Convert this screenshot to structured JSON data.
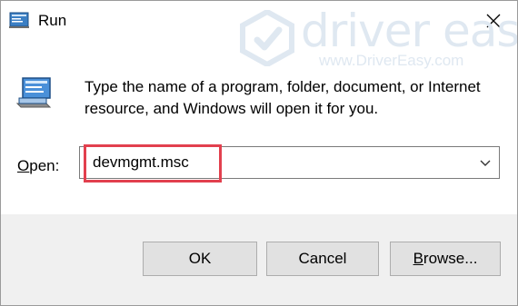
{
  "window": {
    "title": "Run"
  },
  "watermark": {
    "brand": "driver easy",
    "url": "www.DriverEasy.com"
  },
  "description": "Type the name of a program, folder, document, or Internet resource, and Windows will open it for you.",
  "open": {
    "label": "Open:",
    "value": "devmgmt.msc"
  },
  "buttons": {
    "ok": "OK",
    "cancel": "Cancel",
    "browse_first": "B",
    "browse_rest": "rowse..."
  },
  "colors": {
    "highlight": "#e2404e",
    "footer": "#f0f0f0",
    "button": "#e1e1e1"
  },
  "icons": [
    "run-app-icon",
    "close-icon",
    "run-large-icon",
    "chevron-down-icon",
    "drivereasy-logo-icon"
  ]
}
